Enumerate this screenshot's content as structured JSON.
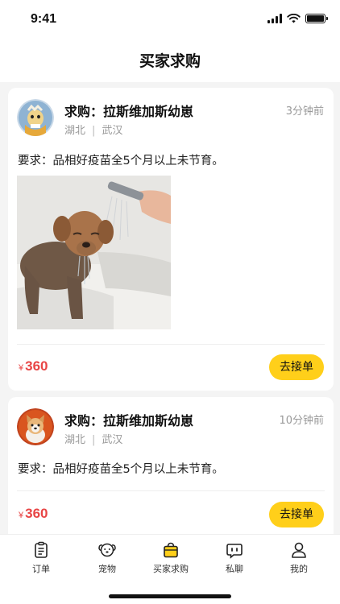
{
  "status_bar": {
    "time": "9:41"
  },
  "header": {
    "title": "买家求购"
  },
  "requests": [
    {
      "title": "求购：拉斯维加斯幼崽",
      "province": "湖北",
      "city": "武汉",
      "time_ago": "3分钟前",
      "requirement": "要求：品相好疫苗全5个月以上未节育。",
      "currency": "¥",
      "price": "360",
      "action": "去接单"
    },
    {
      "title": "求购：拉斯维加斯幼崽",
      "province": "湖北",
      "city": "武汉",
      "time_ago": "10分钟前",
      "requirement": "要求：品相好疫苗全5个月以上未节育。",
      "currency": "¥",
      "price": "360",
      "action": "去接单"
    }
  ],
  "tabbar": {
    "items": [
      {
        "label": "订单",
        "icon": "clipboard-icon"
      },
      {
        "label": "宠物",
        "icon": "dog-icon"
      },
      {
        "label": "买家求购",
        "icon": "shopping-bag-icon",
        "active": true
      },
      {
        "label": "私聊",
        "icon": "chat-icon"
      },
      {
        "label": "我的",
        "icon": "person-icon"
      }
    ],
    "active_color": "#ffcf1a"
  },
  "colors": {
    "accent": "#ffcf1a",
    "price": "#e84545"
  }
}
